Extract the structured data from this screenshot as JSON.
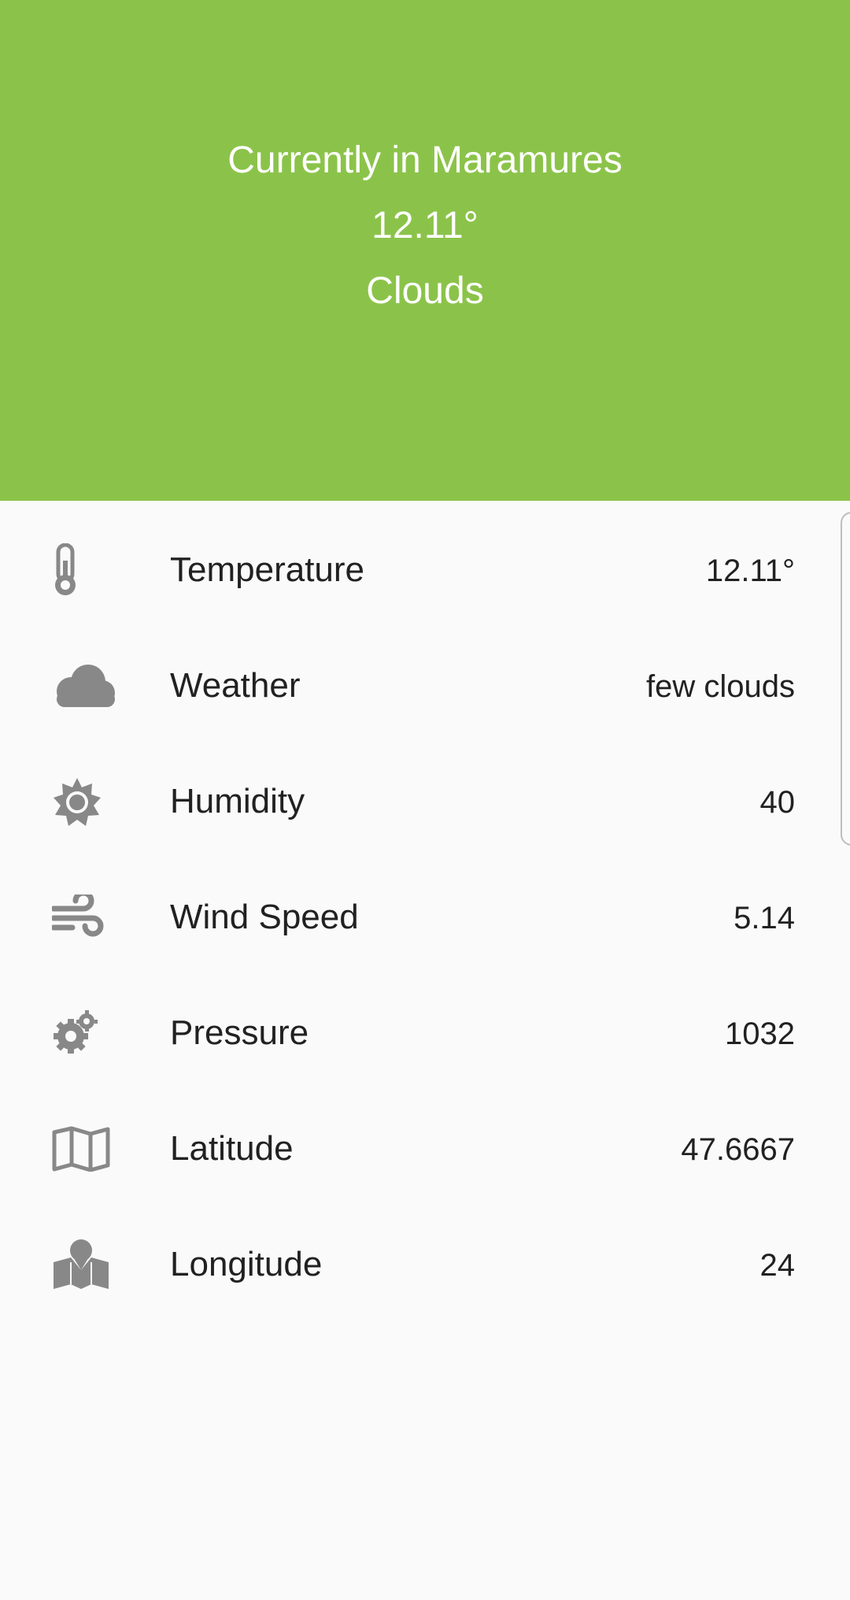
{
  "header": {
    "title": "Currently in Maramures",
    "temperature": "12.11°",
    "description": "Clouds",
    "background_color": "#8bc34a"
  },
  "details": [
    {
      "icon": "thermometer-icon",
      "label": "Temperature",
      "value": "12.11°"
    },
    {
      "icon": "cloud-icon",
      "label": "Weather",
      "value": "few clouds"
    },
    {
      "icon": "sun-icon",
      "label": "Humidity",
      "value": "40"
    },
    {
      "icon": "wind-icon",
      "label": "Wind Speed",
      "value": "5.14"
    },
    {
      "icon": "gears-icon",
      "label": "Pressure",
      "value": "1032"
    },
    {
      "icon": "map-icon",
      "label": "Latitude",
      "value": "47.6667"
    },
    {
      "icon": "map-marker-icon",
      "label": "Longitude",
      "value": "24"
    }
  ],
  "colors": {
    "icon": "#888888",
    "text": "#212121",
    "background": "#fafafa"
  }
}
